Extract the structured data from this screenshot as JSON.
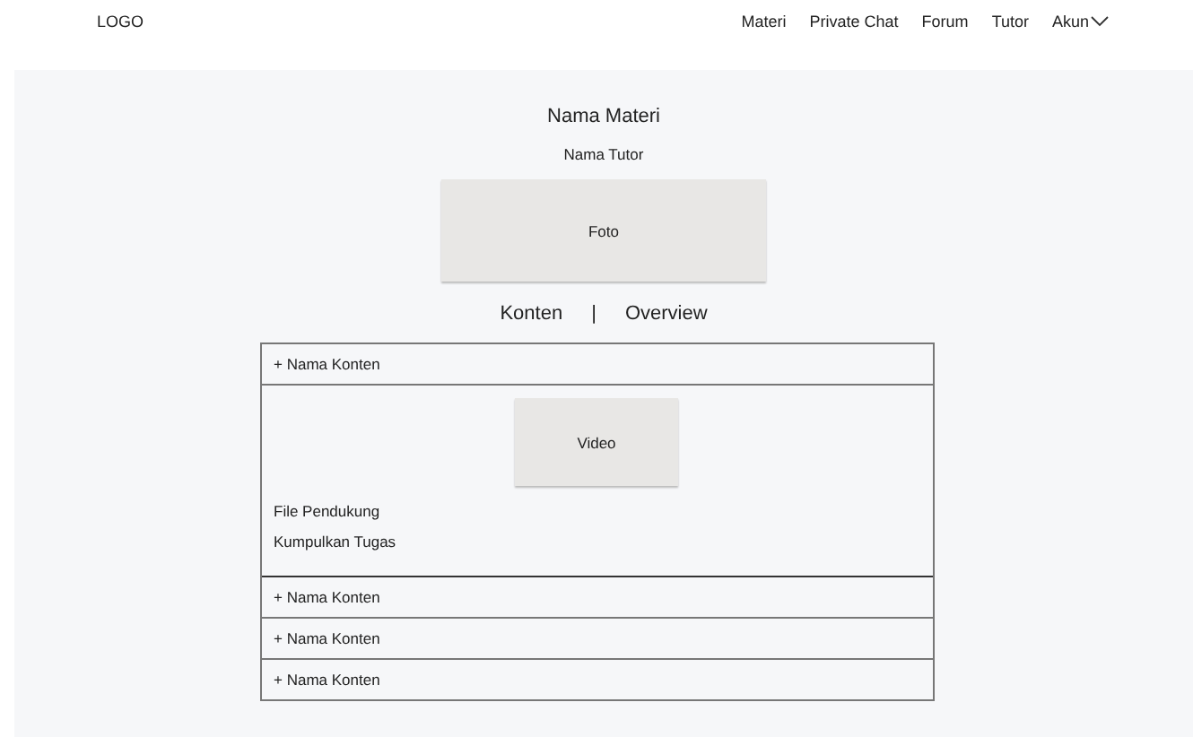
{
  "header": {
    "logo": "LOGO",
    "nav": [
      {
        "label": "Materi",
        "dropdown": false
      },
      {
        "label": "Private Chat",
        "dropdown": false
      },
      {
        "label": "Forum",
        "dropdown": false
      },
      {
        "label": "Tutor",
        "dropdown": false
      },
      {
        "label": "Akun",
        "dropdown": true
      }
    ]
  },
  "course": {
    "title": "Nama Materi",
    "tutor": "Nama Tutor",
    "photo": "Foto"
  },
  "tabs": {
    "items": [
      "Konten",
      "Overview"
    ],
    "separator": "|"
  },
  "contents": [
    {
      "label": "+ Nama Konten",
      "expanded": true,
      "media": "Video",
      "links": [
        "File Pendukung",
        "Kumpulkan Tugas"
      ]
    },
    {
      "label": "+ Nama Konten",
      "expanded": false
    },
    {
      "label": "+ Nama Konten",
      "expanded": false
    },
    {
      "label": "+ Nama Konten",
      "expanded": false
    }
  ]
}
